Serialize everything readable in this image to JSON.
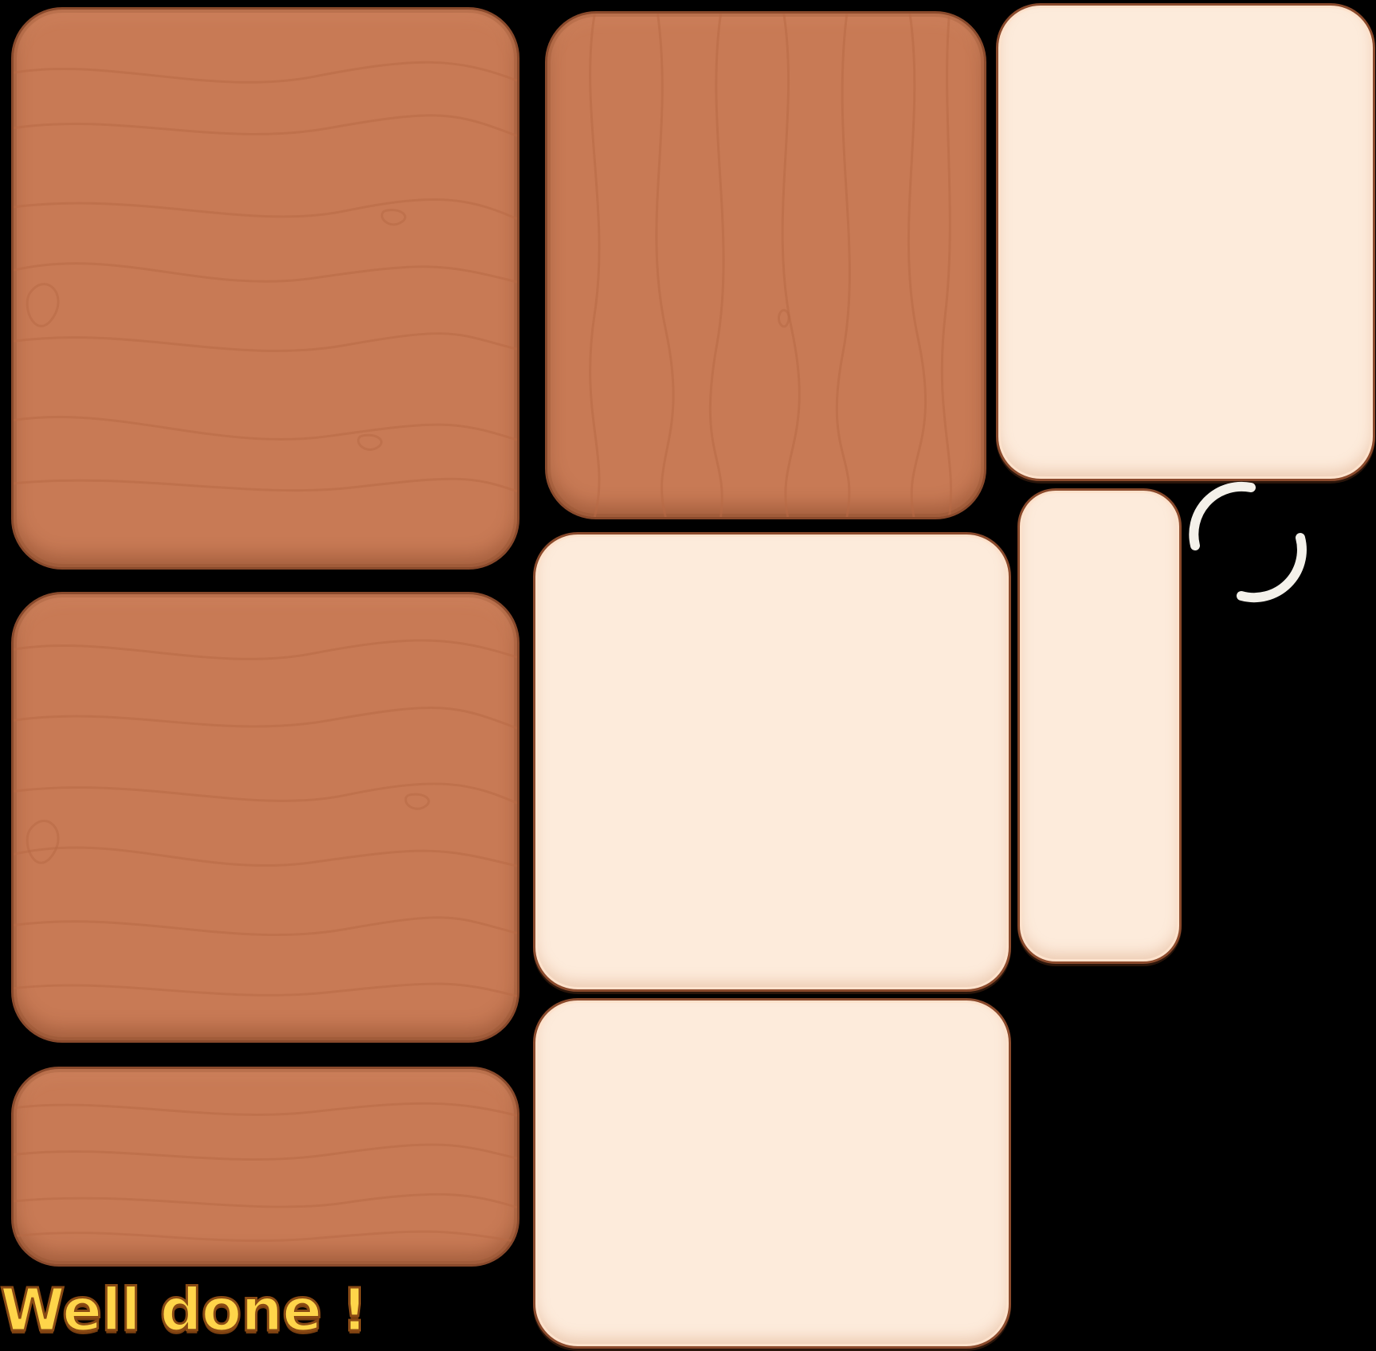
{
  "sprite_sheet": {
    "background_color": "#000000",
    "wood_color": "#c87a55",
    "wood_grain_color": "#b86a45",
    "wood_border_color": "#8a4a2c",
    "cream_color": "#fdebdb",
    "spinner_color": "#f4f1ea",
    "banner_text_color": "#ffd54a",
    "banner_text_outline": "#8a4a14",
    "banner_text": "Well done !"
  }
}
